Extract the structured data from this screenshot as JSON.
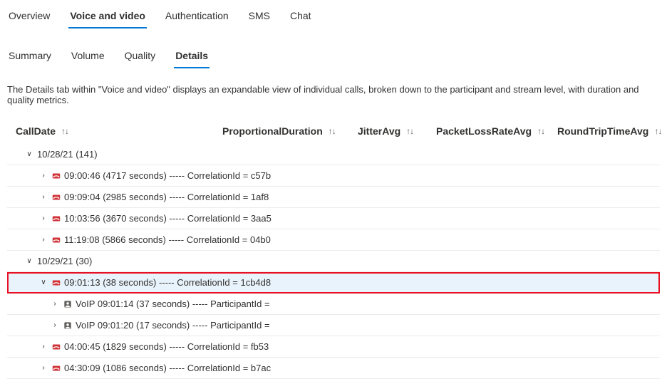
{
  "tabs1": {
    "items": [
      "Overview",
      "Voice and video",
      "Authentication",
      "SMS",
      "Chat"
    ],
    "activeIndex": 1
  },
  "tabs2": {
    "items": [
      "Summary",
      "Volume",
      "Quality",
      "Details"
    ],
    "activeIndex": 3
  },
  "description": "The Details tab within \"Voice and video\" displays an expandable view of individual calls, broken down to the participant and stream level, with duration and quality metrics.",
  "columns": {
    "callDate": "CallDate",
    "proportionalDuration": "ProportionalDuration",
    "jitterAvg": "JitterAvg",
    "packetLossRateAvg": "PacketLossRateAvg",
    "roundTripTimeAvg": "RoundTripTimeAvg"
  },
  "rows": [
    {
      "type": "date",
      "expanded": true,
      "label": "10/28/21 (141)"
    },
    {
      "type": "call",
      "expanded": false,
      "label": "09:00:46 (4717 seconds) ----- CorrelationId = c57b"
    },
    {
      "type": "call",
      "expanded": false,
      "label": "09:09:04 (2985 seconds) ----- CorrelationId = 1af8"
    },
    {
      "type": "call",
      "expanded": false,
      "label": "10:03:56 (3670 seconds) ----- CorrelationId = 3aa5"
    },
    {
      "type": "call",
      "expanded": false,
      "label": "11:19:08 (5866 seconds) ----- CorrelationId = 04b0"
    },
    {
      "type": "date",
      "expanded": true,
      "label": "10/29/21 (30)"
    },
    {
      "type": "call",
      "expanded": true,
      "highlight": true,
      "label": "09:01:13 (38 seconds) ----- CorrelationId = 1cb4d8"
    },
    {
      "type": "participant",
      "expanded": false,
      "label": "VoIP 09:01:14 (37 seconds) ----- ParticipantId ="
    },
    {
      "type": "participant",
      "expanded": false,
      "label": "VoIP 09:01:20 (17 seconds) ----- ParticipantId ="
    },
    {
      "type": "call",
      "expanded": false,
      "label": "04:00:45 (1829 seconds) ----- CorrelationId = fb53"
    },
    {
      "type": "call",
      "expanded": false,
      "label": "04:30:09 (1086 seconds) ----- CorrelationId = b7ac"
    }
  ]
}
